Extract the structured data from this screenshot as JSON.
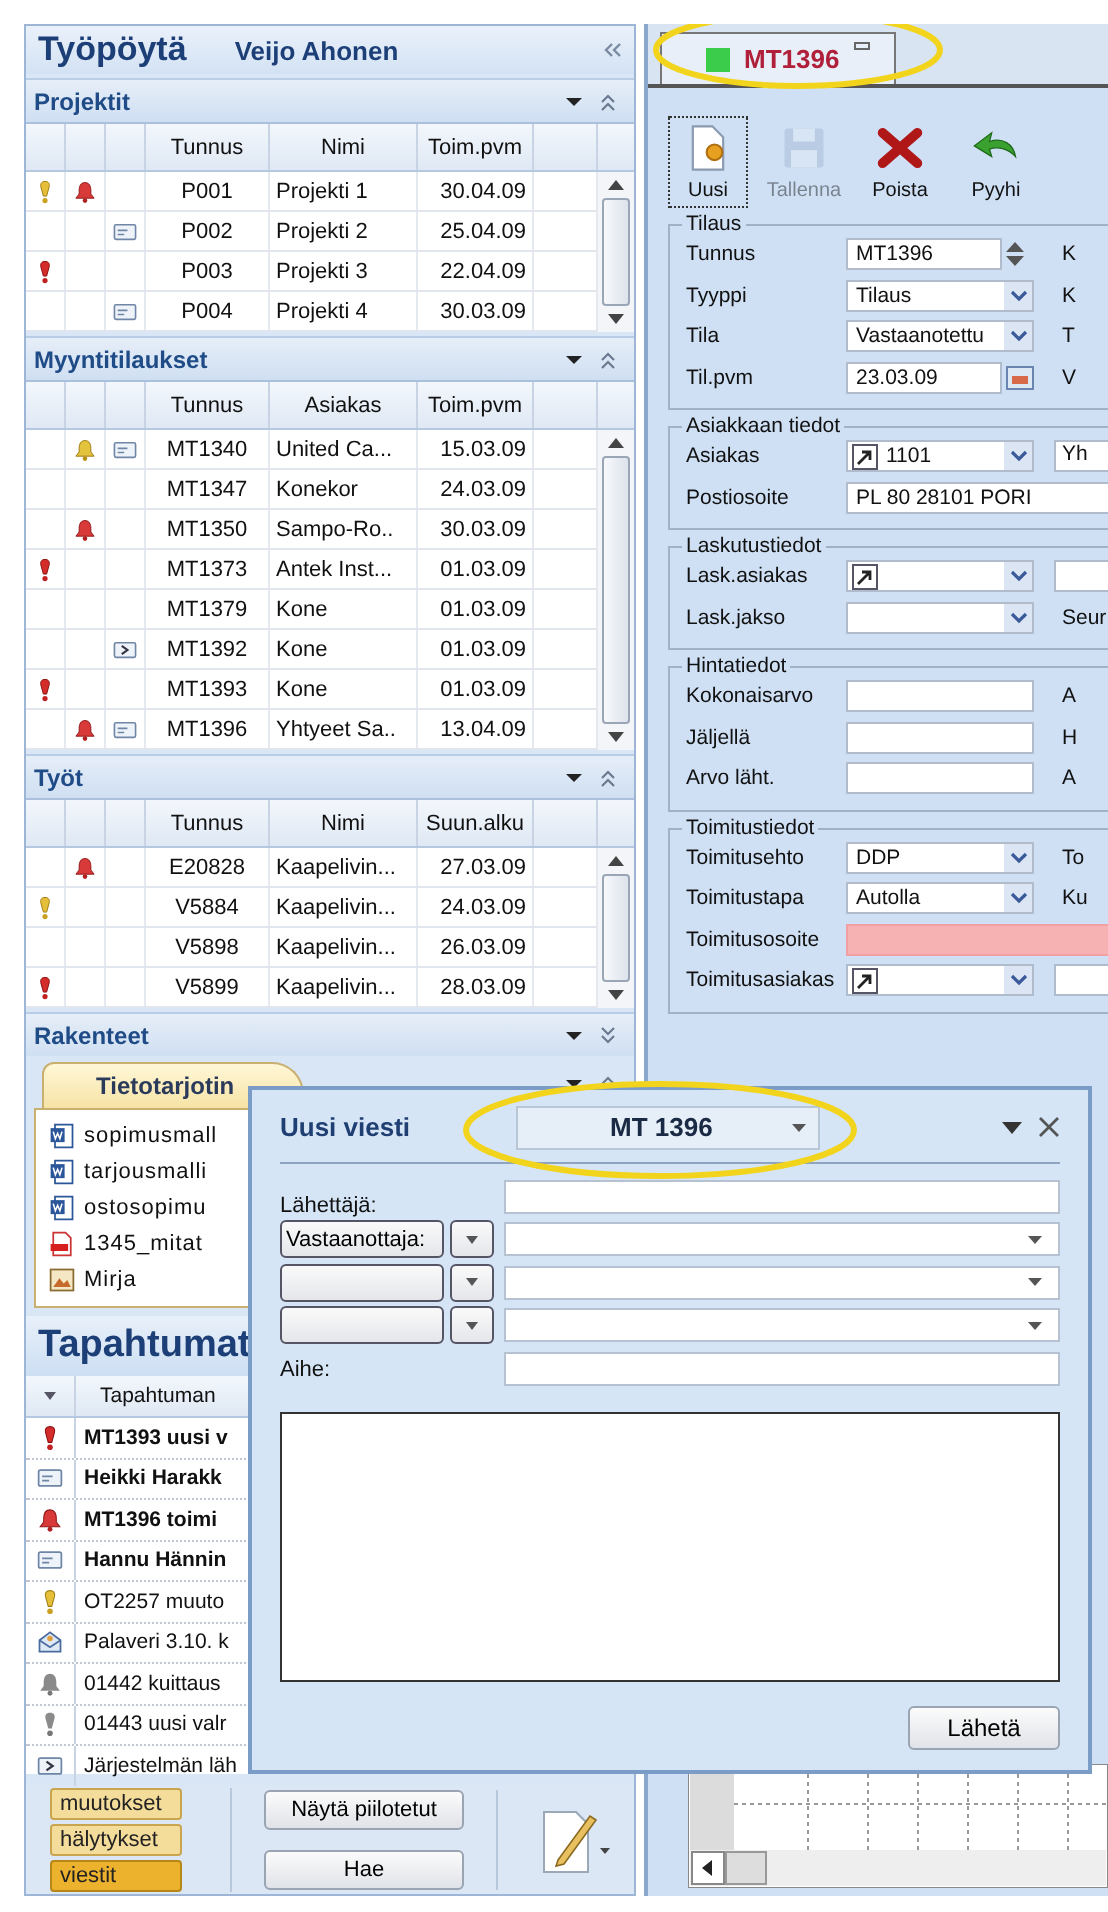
{
  "workspace": {
    "title": "Työpöytä",
    "user": "Veijo Ahonen"
  },
  "sections": [
    {
      "kind": "table",
      "title": "Projektit",
      "expanded": true,
      "columns": [
        "Tunnus",
        "Nimi",
        "Toim.pvm"
      ],
      "rows": [
        {
          "flag": {
            "kind": "notice"
          },
          "alarm": {
            "kind": "new"
          },
          "cells": [
            "P001",
            "Projekti 1",
            "30.04.09"
          ]
        },
        {
          "message": {
            "kind": "mail"
          },
          "cells": [
            "P002",
            "Projekti 2",
            "25.04.09"
          ]
        },
        {
          "flag": {
            "kind": "urgent"
          },
          "cells": [
            "P003",
            "Projekti 3",
            "22.04.09"
          ]
        },
        {
          "message": {
            "kind": "mail"
          },
          "cells": [
            "P004",
            "Projekti 4",
            "30.03.09"
          ]
        }
      ]
    },
    {
      "kind": "table",
      "title": "Myyntitilaukset",
      "expanded": true,
      "columns": [
        "Tunnus",
        "Asiakas",
        "Toim.pvm"
      ],
      "rows": [
        {
          "alarm": {
            "kind": "seen"
          },
          "message": {
            "kind": "mail"
          },
          "cells": [
            "MT1340",
            "United Ca...",
            "15.03.09"
          ]
        },
        {
          "cells": [
            "MT1347",
            "Konekor",
            "24.03.09"
          ]
        },
        {
          "alarm": {
            "kind": "new"
          },
          "cells": [
            "MT1350",
            "Sampo-Ro..",
            "30.03.09"
          ]
        },
        {
          "flag": {
            "kind": "urgent"
          },
          "cells": [
            "MT1373",
            "Antek Inst...",
            "01.03.09"
          ]
        },
        {
          "cells": [
            "MT1379",
            "Kone",
            "01.03.09"
          ]
        },
        {
          "message": {
            "kind": "system"
          },
          "cells": [
            "MT1392",
            "Kone",
            "01.03.09"
          ]
        },
        {
          "flag": {
            "kind": "urgent"
          },
          "cells": [
            "MT1393",
            "Kone",
            "01.03.09"
          ]
        },
        {
          "alarm": {
            "kind": "new"
          },
          "message": {
            "kind": "mail"
          },
          "cells": [
            "MT1396",
            "Yhtyeet Sa..",
            "13.04.09"
          ]
        }
      ]
    },
    {
      "kind": "table",
      "title": "Työt",
      "expanded": true,
      "columns": [
        "Tunnus",
        "Nimi",
        "Suun.alku"
      ],
      "rows": [
        {
          "alarm": {
            "kind": "new"
          },
          "cells": [
            "E20828",
            "Kaapelivin...",
            "27.03.09"
          ]
        },
        {
          "flag": {
            "kind": "notice"
          },
          "cells": [
            "V5884",
            "Kaapelivin...",
            "24.03.09"
          ]
        },
        {
          "cells": [
            "V5898",
            "Kaapelivin...",
            "26.03.09"
          ]
        },
        {
          "flag": {
            "kind": "urgent"
          },
          "cells": [
            "V5899",
            "Kaapelivin...",
            "28.03.09"
          ]
        }
      ]
    },
    {
      "kind": "table",
      "title": "Rakenteet",
      "expanded": false
    },
    {
      "kind": "tray",
      "title": "Tietotarjotin",
      "expanded": true,
      "files": [
        {
          "kind": "word",
          "name": "sopimusmall"
        },
        {
          "kind": "word",
          "name": "tarjousmalli"
        },
        {
          "kind": "word",
          "name": "ostosopimu"
        },
        {
          "kind": "pdf",
          "name": "1345_mitat"
        },
        {
          "kind": "image",
          "name": "Mirja"
        }
      ]
    }
  ],
  "events": {
    "title": "Tapahtumat",
    "column": "Tapahtuman",
    "rows": [
      {
        "kind": "urgent",
        "text": "MT1393 uusi v",
        "unread": true
      },
      {
        "kind": "mail",
        "text": "Heikki Harakk",
        "unread": true
      },
      {
        "kind": "alarm",
        "text": "MT1396 toimi",
        "unread": true
      },
      {
        "kind": "mail",
        "text": "Hannu Hännin",
        "unread": true
      },
      {
        "kind": "notice",
        "text": "OT2257 muuto",
        "unread": false
      },
      {
        "kind": "meeting",
        "text": "Palaveri 3.10. k",
        "unread": false
      },
      {
        "kind": "alarm-done",
        "text": "01442 kuittaus",
        "unread": false
      },
      {
        "kind": "notice-done",
        "text": "01443 uusi valr",
        "unread": false
      },
      {
        "kind": "system",
        "text": "Järjestelmän läh",
        "unread": false
      }
    ]
  },
  "filters": [
    {
      "label": "muutokset",
      "selected": false
    },
    {
      "label": "hälytykset",
      "selected": false
    },
    {
      "label": "viestit",
      "selected": true
    }
  ],
  "buttons": [
    "Näytä piilotetut",
    "Hae"
  ],
  "document_tab": {
    "title": "MT1396",
    "color": "#3ccc4c",
    "highlighted": true
  },
  "toolbar": [
    {
      "kind": "new",
      "label": "Uusi",
      "disabled": false,
      "focused": true
    },
    {
      "kind": "save",
      "label": "Tallenna",
      "disabled": true,
      "focused": false
    },
    {
      "kind": "delete",
      "label": "Poista",
      "disabled": false,
      "focused": false
    },
    {
      "kind": "undo",
      "label": "Pyyhi",
      "disabled": false,
      "focused": false
    }
  ],
  "groups": [
    {
      "title": "Tilaus",
      "rows": [
        {
          "label": "Tunnus",
          "kind": "spin",
          "value": "MT1396",
          "side": {
            "kind": "label",
            "text": "K"
          }
        },
        {
          "label": "Tyyppi",
          "kind": "select",
          "value": "Tilaus",
          "side": {
            "kind": "label",
            "text": "K"
          }
        },
        {
          "label": "Tila",
          "kind": "select",
          "value": "Vastaanotettu",
          "side": {
            "kind": "label",
            "text": "T"
          }
        },
        {
          "label": "Til.pvm",
          "kind": "date",
          "value": "23.03.09",
          "side": {
            "kind": "label",
            "text": "V"
          }
        }
      ]
    },
    {
      "title": "Asiakkaan tiedot",
      "rows": [
        {
          "label": "Asiakas",
          "kind": "link-select",
          "value": "1101",
          "side": {
            "kind": "field",
            "value": "Yh"
          }
        },
        {
          "label": "Postiosoite",
          "kind": "wide",
          "value": "PL 80 28101 PORI"
        }
      ]
    },
    {
      "title": "Laskutustiedot",
      "rows": [
        {
          "label": "Lask.asiakas",
          "kind": "link-select",
          "side": {
            "kind": "field"
          }
        },
        {
          "label": "Lask.jakso",
          "kind": "select",
          "side": {
            "kind": "label",
            "text": "Seur"
          }
        }
      ]
    },
    {
      "title": "Hintatiedot",
      "rows": [
        {
          "label": "Kokonaisarvo",
          "kind": "text",
          "side": {
            "kind": "label",
            "text": "A"
          }
        },
        {
          "label": "Jäljellä",
          "kind": "text",
          "side": {
            "kind": "label",
            "text": "H"
          }
        },
        {
          "label": "Arvo läht.",
          "kind": "text",
          "side": {
            "kind": "label",
            "text": "A"
          }
        }
      ]
    },
    {
      "title": "Toimitustiedot",
      "rows": [
        {
          "label": "Toimitusehto",
          "kind": "select",
          "value": "DDP",
          "side": {
            "kind": "label",
            "text": "To"
          }
        },
        {
          "label": "Toimitustapa",
          "kind": "select",
          "value": "Autolla",
          "side": {
            "kind": "label",
            "text": "Ku"
          }
        },
        {
          "label": "Toimitusosoite",
          "kind": "required-wide"
        },
        {
          "label": "Toimitusasiakas",
          "kind": "link-select",
          "side": {
            "kind": "field"
          }
        }
      ]
    }
  ],
  "message": {
    "title": "Uusi viesti",
    "target": "MT 1396",
    "highlighted": true,
    "sender_label": "Lähettäjä:",
    "recipients": [
      {
        "kind": "labelled",
        "label": "Vastaanottaja:"
      },
      {
        "kind": "blank"
      },
      {
        "kind": "blank"
      }
    ],
    "subject_label": "Aihe:",
    "send": "Lähetä"
  }
}
